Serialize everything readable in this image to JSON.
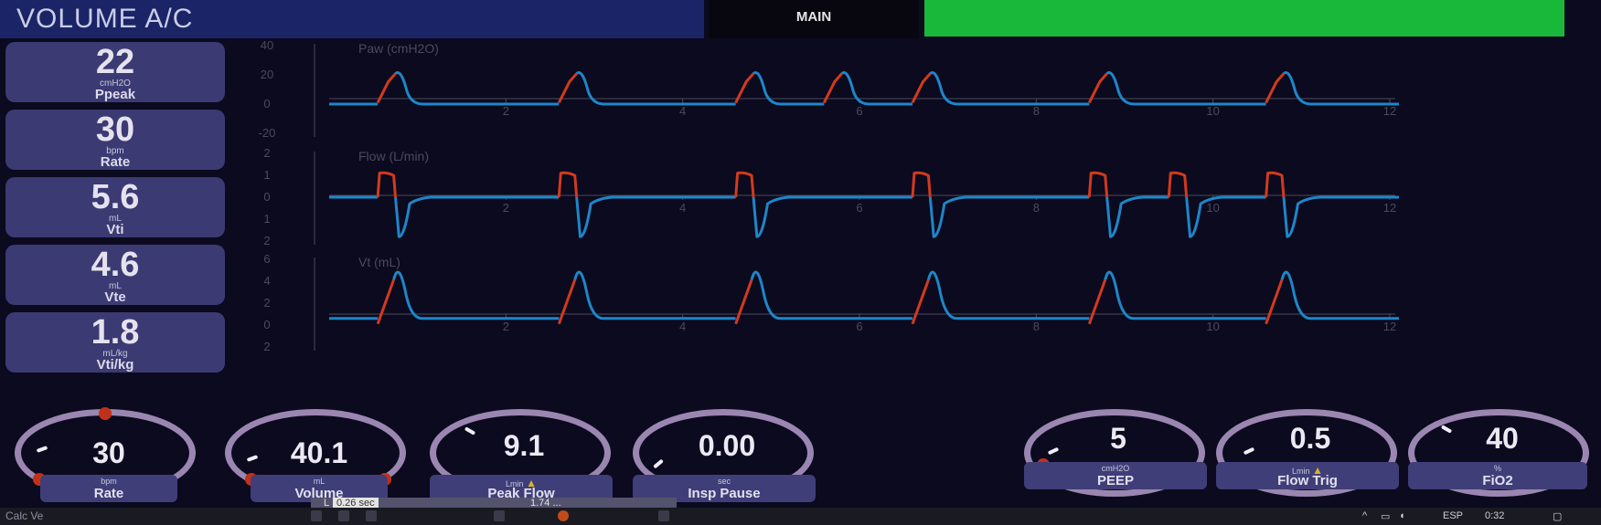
{
  "header": {
    "mode": "VOLUME A/C",
    "main_tab": "MAIN",
    "status_color": "#19b83a"
  },
  "readouts": [
    {
      "value": "22",
      "unit": "cmH2O",
      "label": "Ppeak"
    },
    {
      "value": "30",
      "unit": "bpm",
      "label": "Rate"
    },
    {
      "value": "5.6",
      "unit": "mL",
      "label": "Vti"
    },
    {
      "value": "4.6",
      "unit": "mL",
      "label": "Vte"
    },
    {
      "value": "1.8",
      "unit": "mL/kg",
      "label": "Vti/kg"
    }
  ],
  "chart_data": [
    {
      "type": "line",
      "title": "Paw (cmH2O)",
      "x_ticks": [
        "2",
        "4",
        "6",
        "8",
        "10",
        "12"
      ],
      "y_ticks": [
        "40",
        "20",
        "0",
        "-20"
      ],
      "xlim": [
        0,
        12
      ],
      "ylim": [
        -20,
        40
      ],
      "baseline": 0,
      "peak": 22,
      "breath_starts": [
        0.55,
        2.6,
        4.6,
        5.6,
        6.6,
        8.6,
        10.6
      ]
    },
    {
      "type": "line",
      "title": "Flow (L/min)",
      "x_ticks": [
        "2",
        "4",
        "6",
        "8",
        "10",
        "12"
      ],
      "y_ticks": [
        "2",
        "1",
        "0",
        "1",
        "2"
      ],
      "xlim": [
        0,
        12
      ],
      "ylim": [
        -2,
        2
      ],
      "baseline": 0,
      "peak": 1.1,
      "trough": -1.8,
      "breath_starts": [
        0.55,
        2.6,
        4.6,
        6.6,
        8.6,
        9.5,
        10.6
      ]
    },
    {
      "type": "line",
      "title": "Vt (mL)",
      "x_ticks": [
        "2",
        "4",
        "6",
        "8",
        "10",
        "12"
      ],
      "y_ticks": [
        "6",
        "4",
        "2",
        "0",
        "2"
      ],
      "xlim": [
        0,
        12
      ],
      "ylim": [
        -2,
        6
      ],
      "baseline": 0.6,
      "peak": 5.5,
      "breath_starts": [
        0.55,
        2.6,
        4.6,
        6.6,
        8.6,
        10.6
      ]
    }
  ],
  "controls": [
    {
      "value": "30",
      "unit": "bpm",
      "label": "Rate",
      "warning": false
    },
    {
      "value": "40.1",
      "unit": "mL",
      "label": "Volume",
      "warning": false
    },
    {
      "value": "9.1",
      "unit": "Lmin",
      "label": "Peak Flow",
      "warning": true
    },
    {
      "value": "0.00",
      "unit": "sec",
      "label": "Insp Pause",
      "warning": false
    },
    {
      "value": "5",
      "unit": "cmH2O",
      "label": "PEEP",
      "warning": false
    },
    {
      "value": "0.5",
      "unit": "Lmin",
      "label": "Flow Trig",
      "warning": true
    },
    {
      "value": "40",
      "unit": "%",
      "label": "FiO2",
      "warning": false
    }
  ],
  "infobar": {
    "left": "L",
    "insp_time": "0.26 sec",
    "peak_flow": "1.74 ..."
  },
  "taskbar": {
    "left_text": "Calc Ve",
    "lang": "ESP",
    "time": "0:32"
  },
  "colors": {
    "insp": "#d23a1e",
    "exp": "#1e86c9",
    "panel": "#3b3a73",
    "dial": "#9b86b1",
    "axis": "#4c4a5c"
  }
}
